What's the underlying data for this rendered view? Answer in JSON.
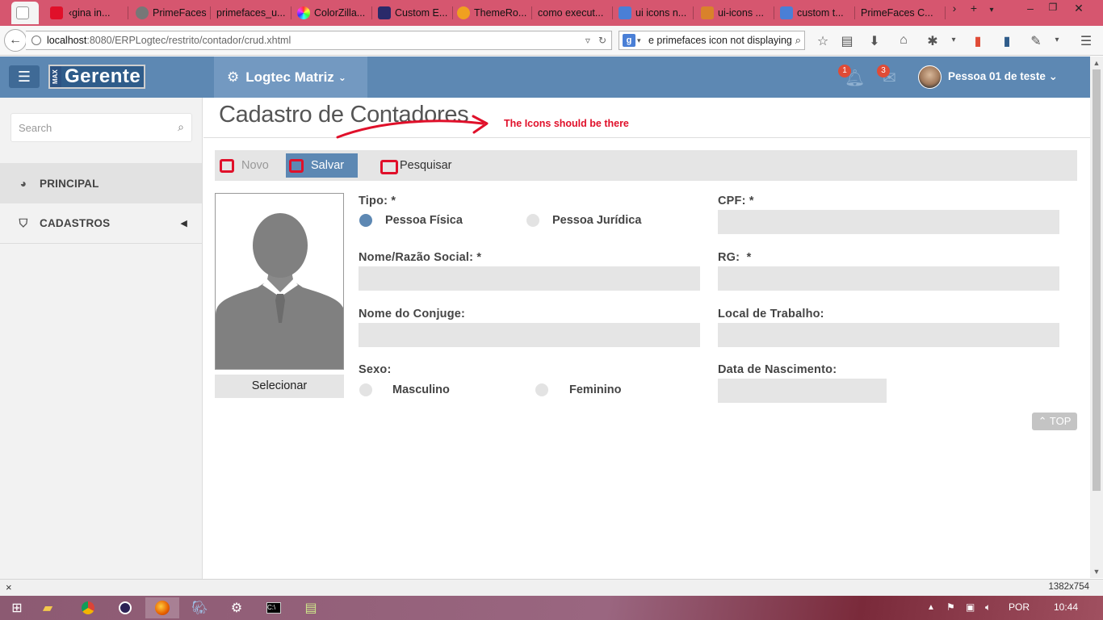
{
  "browser": {
    "tabs": [
      {
        "label": "",
        "active": true
      },
      {
        "label": "gina in..."
      },
      {
        "label": "PrimeFaces"
      },
      {
        "label": "primefaces_u..."
      },
      {
        "label": "ColorZilla..."
      },
      {
        "label": "Custom E..."
      },
      {
        "label": "ThemeRo..."
      },
      {
        "label": "como execut..."
      },
      {
        "label": "ui icons n..."
      },
      {
        "label": "ui-icons ..."
      },
      {
        "label": "custom t..."
      },
      {
        "label": "PrimeFaces C..."
      }
    ],
    "url_host": "localhost",
    "url_rest": ":8080/ERPLogtec/restrito/contador/crud.xhtml",
    "search_text": "e primefaces icon not displaying"
  },
  "header": {
    "logo_small": "MAX",
    "logo_text": "Gerente",
    "company": "Logtec Matriz",
    "notifications_count": "1",
    "messages_count": "3",
    "user_name": "Pessoa 01 de teste"
  },
  "sidebar": {
    "search_placeholder": "Search",
    "items": [
      {
        "label": "PRINCIPAL",
        "icon": "dashboard-icon"
      },
      {
        "label": "CADASTROS",
        "icon": "bookmark-icon"
      }
    ]
  },
  "page": {
    "title": "Cadastro de Contadores",
    "annotation": "The Icons should be there",
    "toolbar": {
      "novo": "Novo",
      "salvar": "Salvar",
      "pesquisar": "Pesquisar"
    },
    "photo_button": "Selecionar",
    "form": {
      "tipo_label": "Tipo: *",
      "tipo_options": [
        "Pessoa Física",
        "Pessoa Jurídica"
      ],
      "tipo_selected": "Pessoa Física",
      "cpf_label": "CPF: *",
      "nome_label": "Nome/Razão Social: *",
      "rg_label": "RG:  *",
      "conjuge_label": "Nome do Conjuge:",
      "trabalho_label": "Local de Trabalho:",
      "sexo_label": "Sexo:",
      "sexo_options": [
        "Masculino",
        "Feminino"
      ],
      "nascimento_label": "Data de Nascimento:"
    },
    "top_button": "TOP"
  },
  "status": {
    "resolution": "1382x754"
  },
  "taskbar": {
    "language": "POR",
    "time": "10:44"
  }
}
